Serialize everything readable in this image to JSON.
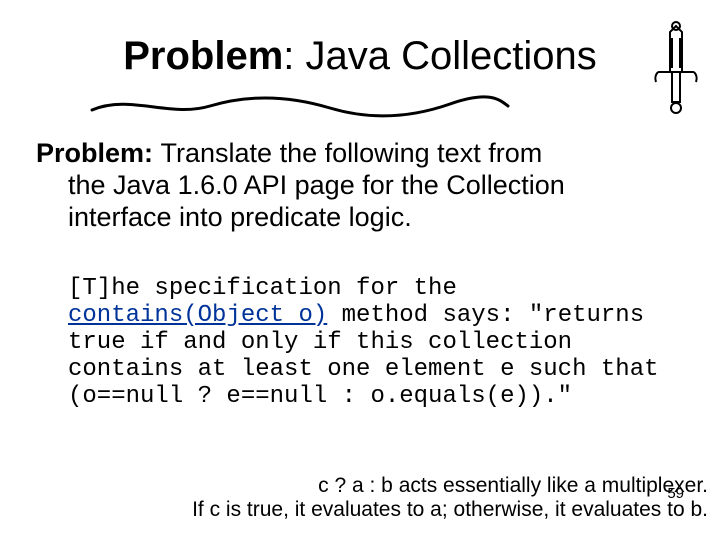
{
  "title": {
    "bold": "Problem",
    "rest": ": Java Collections"
  },
  "problem": {
    "label": "Problem: ",
    "line1_after": "Translate the following text from",
    "line2": "the Java 1.6.0 API page for the Collection",
    "line3": "interface into predicate logic."
  },
  "code": {
    "seg1": "[T]he specification for the ",
    "link": "contains(Object o)",
    "seg2": " method says: \"returns true if and only if this collection contains at least one element e such that (o==null ? e==null : o.equals(e)).\""
  },
  "footnote": {
    "l1": "c ? a : b acts essentially like a multiplexer.",
    "l2": "If c is true, it evaluates to a; otherwise, it evaluates to b."
  },
  "pagenum": "59"
}
